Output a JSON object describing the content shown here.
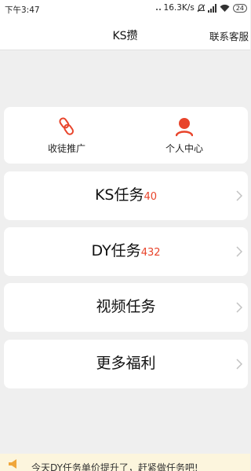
{
  "status_bar": {
    "time": "下午3:47",
    "network_speed": "16.3K/s",
    "battery": "24",
    "icons": [
      "mute-icon",
      "signal-icon",
      "wifi-icon",
      "battery-icon"
    ]
  },
  "nav": {
    "title": "KS攒",
    "service_label": "联系客服"
  },
  "quick_actions": [
    {
      "label": "收徒推广",
      "icon": "link-icon"
    },
    {
      "label": "个人中心",
      "icon": "user-icon"
    }
  ],
  "tasks": [
    {
      "title": "KS任务",
      "count": "40"
    },
    {
      "title": "DY任务",
      "count": "432"
    },
    {
      "title": "视频任务",
      "count": ""
    },
    {
      "title": "更多福利",
      "count": ""
    }
  ],
  "notice": {
    "icon": "speaker-icon",
    "text": "今天DY任务单价提升了，赶紧做任务吧!"
  },
  "colors": {
    "accent": "#e8442b",
    "background": "#efefef",
    "card": "#ffffff",
    "notice_background": "#fcf5dd",
    "notice_icon": "#f0a63a"
  }
}
